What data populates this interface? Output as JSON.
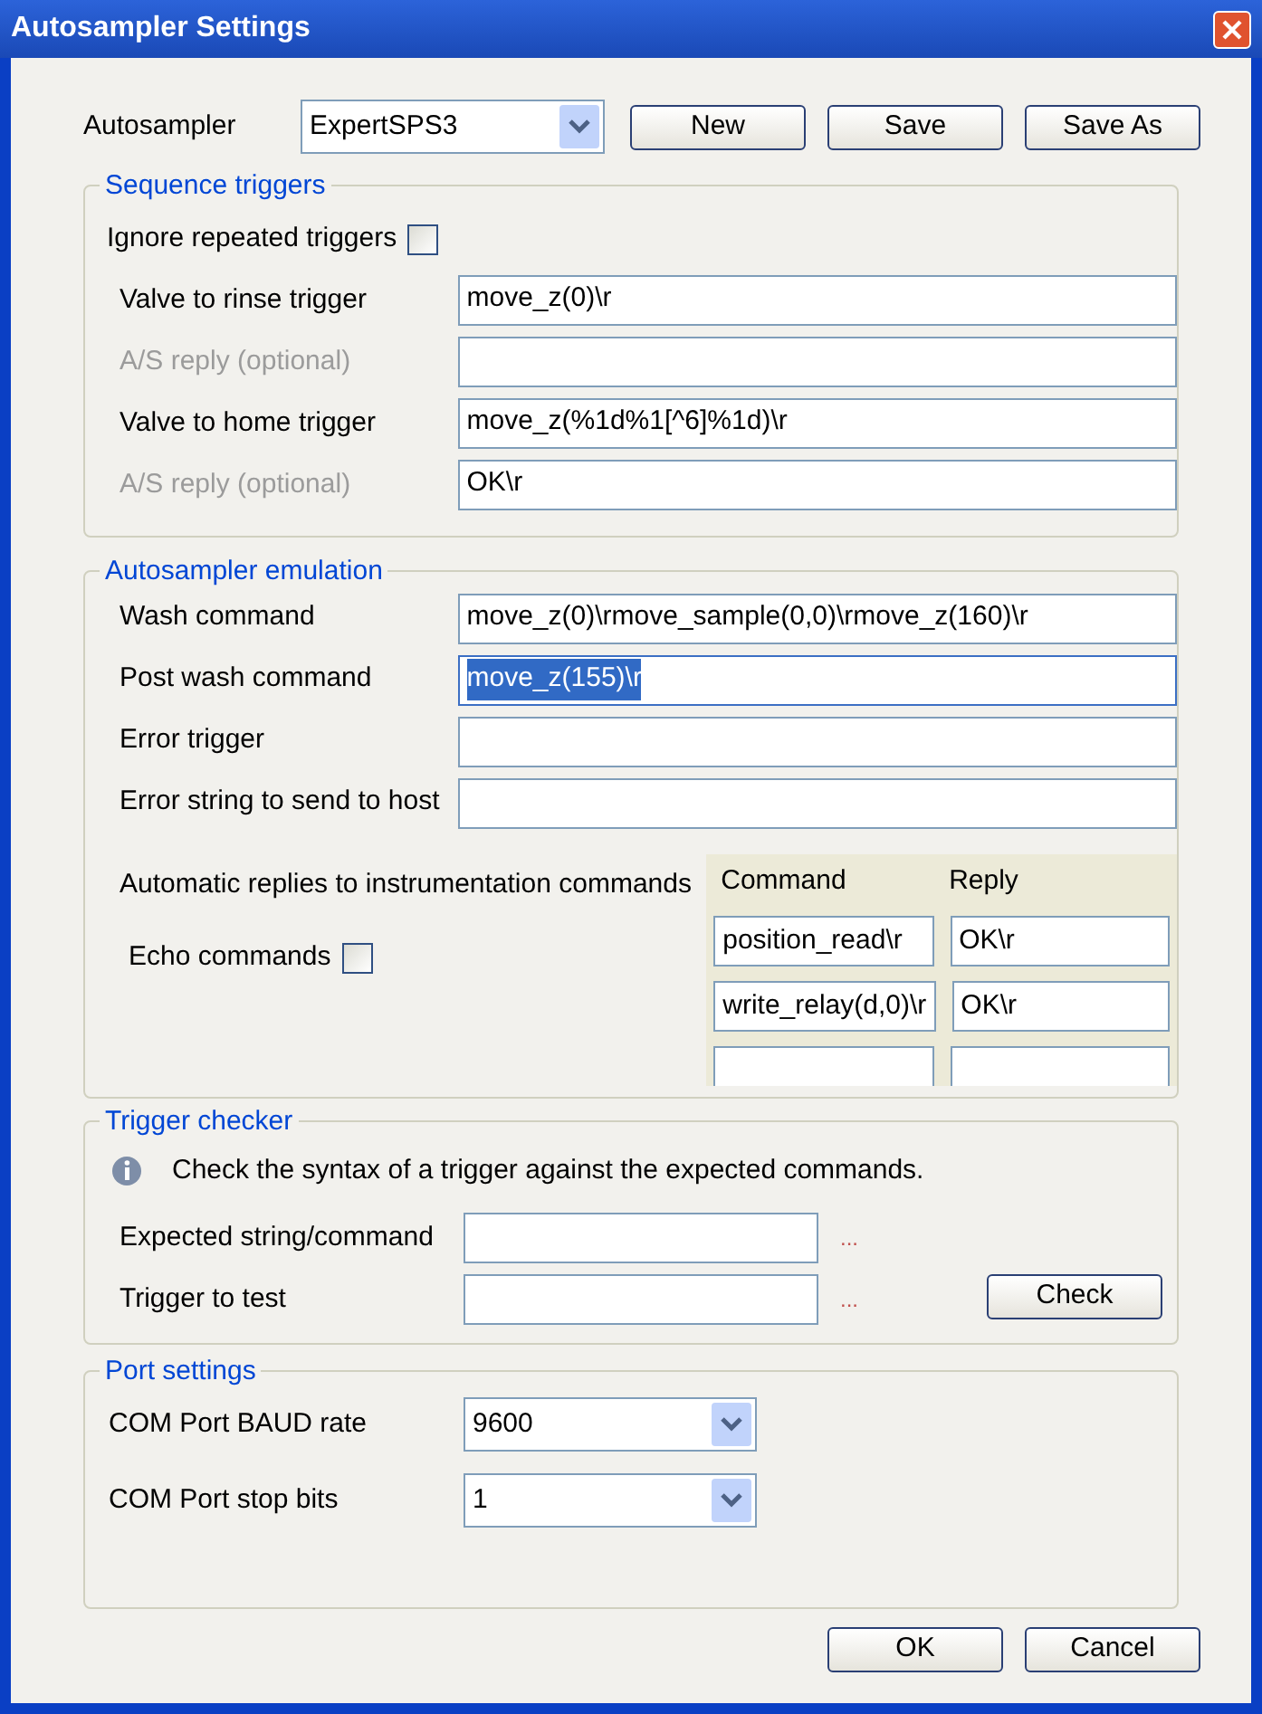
{
  "window": {
    "title": "Autosampler Settings"
  },
  "autosampler": {
    "label": "Autosampler",
    "value": "ExpertSPS3"
  },
  "top_buttons": [
    "New",
    "Save",
    "Save As"
  ],
  "sequence_triggers": {
    "title": "Sequence triggers",
    "ignore_repeated": {
      "label": "Ignore repeated triggers",
      "checked": false
    },
    "rows": [
      {
        "label": "Valve to rinse trigger",
        "value": "move_z(0)\\r",
        "disabled": false
      },
      {
        "label": "A/S reply (optional)",
        "disabled": true
      },
      {
        "label": "Valve to home trigger",
        "value": "move_z(%1d%1[^6]%1d)\\r",
        "disabled": false
      },
      {
        "label": "A/S reply (optional)",
        "value": "OK\\r",
        "disabled": true
      }
    ]
  },
  "emulation": {
    "title": "Autosampler emulation",
    "rows": [
      {
        "label": "Wash command",
        "value": "move_z(0)\\rmove_sample(0,0)\\rmove_z(160)\\r",
        "selected": false
      },
      {
        "label": "Post wash command",
        "value": "move_z(155)\\r",
        "selected": true
      },
      {
        "label": "Error trigger",
        "selected": false
      },
      {
        "label": "Error string to send to host",
        "selected": false
      }
    ],
    "auto_replies_label": "Automatic replies to instrumentation commands",
    "echo": {
      "label": "Echo commands",
      "checked": false
    },
    "table": {
      "columns": [
        "Command",
        "Reply"
      ],
      "rows": [
        [
          "position_read\\r",
          "OK\\r"
        ],
        [
          "write_relay(d,0)\\r",
          "OK\\r"
        ],
        [
          null,
          null
        ]
      ]
    }
  },
  "trigger_checker": {
    "title": "Trigger checker",
    "info": "Check the syntax of a trigger against the expected commands.",
    "rows": [
      {
        "label": "Expected string/command",
        "dots": "..."
      },
      {
        "label": "Trigger to test",
        "dots": "..."
      }
    ],
    "button": "Check"
  },
  "port_settings": {
    "title": "Port settings",
    "rows": [
      {
        "label": "COM Port BAUD rate",
        "value": "9600"
      },
      {
        "label": "COM Port stop bits",
        "value": "1"
      }
    ]
  },
  "dialog_buttons": [
    "OK",
    "Cancel"
  ]
}
